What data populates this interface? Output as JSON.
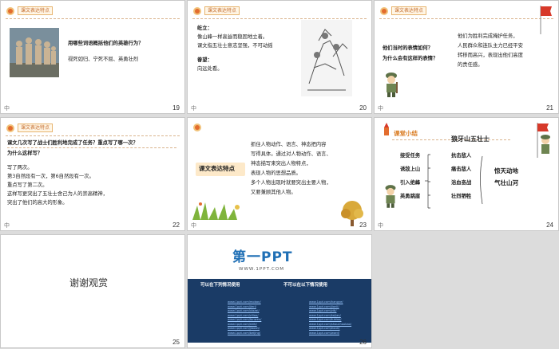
{
  "slides": {
    "s19": {
      "number": "19",
      "corner": "中",
      "tag": "课文表达特点",
      "question": "用哪些词语概括他们的英雄行为？",
      "answer": "视死如归、宁死不屈、英勇壮烈"
    },
    "s20": {
      "number": "20",
      "corner": "中",
      "tag": "课文表达特点",
      "word1": "屹立：",
      "line1a": "像山峰一样高耸而稳固地立着。",
      "line1b": "课文指五壮士意志坚强，不可动摇",
      "word2": "眷望：",
      "line2": "向远处看。"
    },
    "s21": {
      "number": "21",
      "corner": "中",
      "tag": "课文表达特点",
      "q1": "他们当时的表情如何？",
      "q2": "为什么会有这样的表情？",
      "a1": "他们为胜利完成掩护任务，",
      "a2": "人民群众和连队主力已经平安",
      "a3": "转移而高兴，表现出他们高度",
      "a4": "的责任感。"
    },
    "s22": {
      "number": "22",
      "corner": "中",
      "tag": "课文表达特点",
      "q1": "课文几次写了战士们胜利地完成了任务？重点写了哪一次？",
      "q2": "为什么这样写？",
      "l1": "写了两次。",
      "l2": "第3自然段有一次，第6自然段有一次。",
      "l3": "重点写了第二次。",
      "l4": "这样写更突出了五壮士舍己为人的崇高精神，",
      "l5": "突出了他们的高大的形象。"
    },
    "s23": {
      "number": "23",
      "corner": "中",
      "side": "课文表达特点",
      "l1": "抓住人物动作、语言、神态把内容",
      "l2": "写得具体。通过对人物动作、语言、",
      "l3": "神态描写来突出人物特点，",
      "l4": "表现人物的思想品质。",
      "l5": "多个人物出现时就要突出主要人物，",
      "l6": "又要兼顾其他人物。"
    },
    "s24": {
      "number": "24",
      "corner": "中",
      "label": "课堂小结",
      "title": "狼牙山五壮士",
      "left": [
        "接受任务",
        "诱敌上山",
        "引入绝峰",
        "英勇跳崖"
      ],
      "mid": [
        "抗击敌人",
        "痛击敌人",
        "浴血奋战",
        "壮烈牺牲"
      ],
      "right": [
        "惊天动地",
        "气壮山河"
      ]
    },
    "s25": {
      "number": "25",
      "thanks": "谢谢观赏"
    },
    "s26": {
      "number": "26",
      "logo_main": "第一PPT",
      "logo_url": "WWW.1PPT.COM",
      "col1_title": "可以在下列情况使用",
      "col2_title": "不可以在以下情况使用",
      "links": [
        "www.1ppt.com/moban/",
        "www.1ppt.com/jieri/",
        "www.1ppt.com/xiazai/",
        "www.1ppt.com/ziliao/",
        "www.1ppt.com/fanwen/",
        "www.1ppt.com/shiti/",
        "www.1ppt.com/jiaoan/",
        "www.1ppt.com/beijing/"
      ],
      "links2": [
        "www.1ppt.com/hangye/",
        "www.1ppt.com/jianli/",
        "www.1ppt.com/ziti/",
        "www.1ppt.com/kejian/",
        "www.1ppt.com/tubiao/",
        "www.1ppt.com/shouchaobao/",
        "www.1ppt.com/excel/",
        "www.1ppt.com/word/"
      ]
    }
  }
}
